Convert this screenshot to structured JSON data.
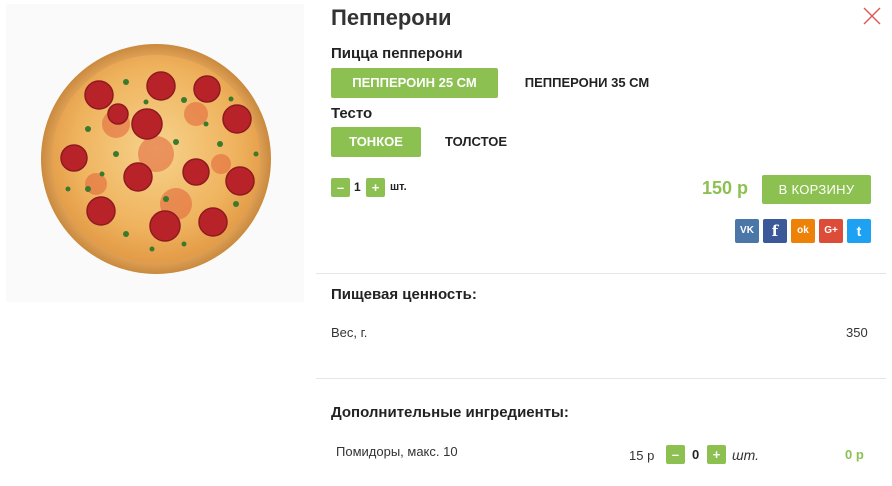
{
  "product": {
    "title": "Пепперони",
    "price": "150 р",
    "cart_button": "В КОРЗИНУ"
  },
  "option_groups": [
    {
      "label": "Пицца пепперони",
      "options": [
        {
          "label": "ПЕППЕРОИН 25 СМ",
          "selected": true
        },
        {
          "label": "ПЕППЕРОНИ 35 СМ",
          "selected": false
        }
      ]
    },
    {
      "label": "Тесто",
      "options": [
        {
          "label": "ТОНКОЕ",
          "selected": true
        },
        {
          "label": "ТОЛСТОЕ",
          "selected": false
        }
      ]
    }
  ],
  "quantity": {
    "minus": "–",
    "value": "1",
    "plus": "+",
    "unit": "шт."
  },
  "social": [
    {
      "icon": "vk-icon",
      "glyph": "VK",
      "color": "#4a76a8"
    },
    {
      "icon": "facebook-icon",
      "glyph": "f",
      "color": "#3b5998"
    },
    {
      "icon": "odnoklassniki-icon",
      "glyph": "ok",
      "color": "#ee8208"
    },
    {
      "icon": "google-plus-icon",
      "glyph": "G+",
      "color": "#dd4b39"
    },
    {
      "icon": "twitter-icon",
      "glyph": "t",
      "color": "#1da1f2"
    }
  ],
  "nutrition": {
    "title": "Пищевая ценность:",
    "rows": [
      {
        "label": "Вес, г.",
        "value": "350"
      }
    ]
  },
  "addons": {
    "title": "Дополнительные ингредиенты:",
    "items": [
      {
        "label": "Помидоры, макс. 10",
        "price": "15 р",
        "minus": "–",
        "qty": "0",
        "plus": "+",
        "unit": "шт.",
        "sum": "0 р"
      }
    ]
  },
  "colors": {
    "accent": "#8cc152",
    "close": "#e05555"
  }
}
